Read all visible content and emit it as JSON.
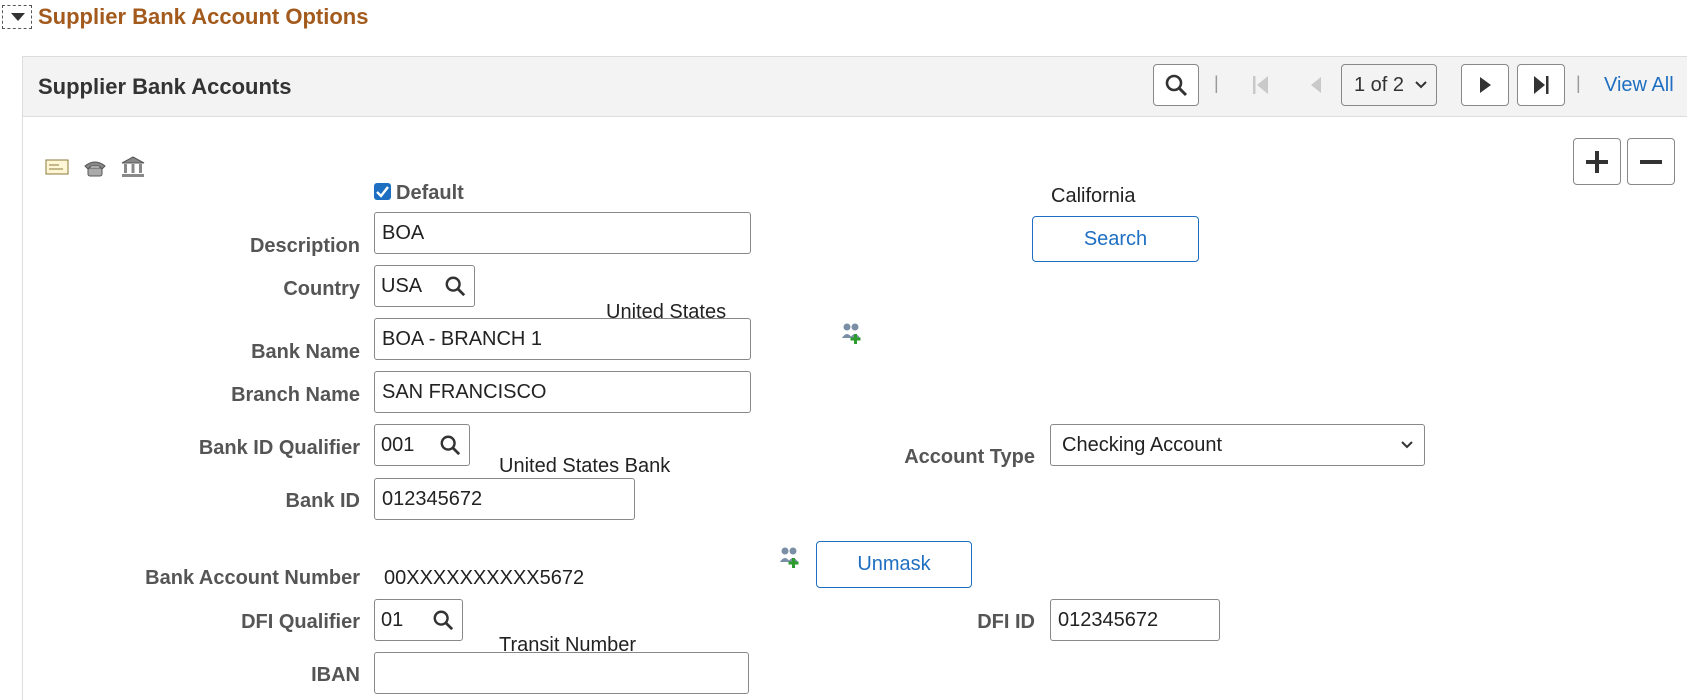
{
  "section": {
    "title": "Supplier Bank Account Options"
  },
  "grid": {
    "title": "Supplier Bank Accounts",
    "pager": {
      "page": "1 of 2",
      "view_all": "View All",
      "separator": "|"
    }
  },
  "form": {
    "default_label": "Default",
    "state_text": "California",
    "search_button": "Search",
    "description": {
      "label": "Description",
      "value": "BOA"
    },
    "country": {
      "label": "Country",
      "value": "USA",
      "desc": "United States"
    },
    "bank_name": {
      "label": "Bank Name",
      "value": "BOA - BRANCH 1"
    },
    "branch_name": {
      "label": "Branch Name",
      "value": "SAN FRANCISCO"
    },
    "bank_id_qualifier": {
      "label": "Bank ID Qualifier",
      "value": "001",
      "desc": "United States Bank"
    },
    "account_type": {
      "label": "Account Type",
      "value": "Checking Account"
    },
    "bank_id": {
      "label": "Bank ID",
      "value": "012345672"
    },
    "bank_account_number": {
      "label": "Bank Account Number",
      "value": "00XXXXXXXXXX5672"
    },
    "unmask_button": "Unmask",
    "dfi_qualifier": {
      "label": "DFI Qualifier",
      "value": "01",
      "desc": "Transit Number"
    },
    "dfi_id": {
      "label": "DFI ID",
      "value": "012345672"
    },
    "iban": {
      "label": "IBAN",
      "value": ""
    }
  },
  "colors": {
    "accent": "#1e6fc1",
    "section_title": "#a35a1d",
    "header_bg": "#f3f3f3"
  }
}
